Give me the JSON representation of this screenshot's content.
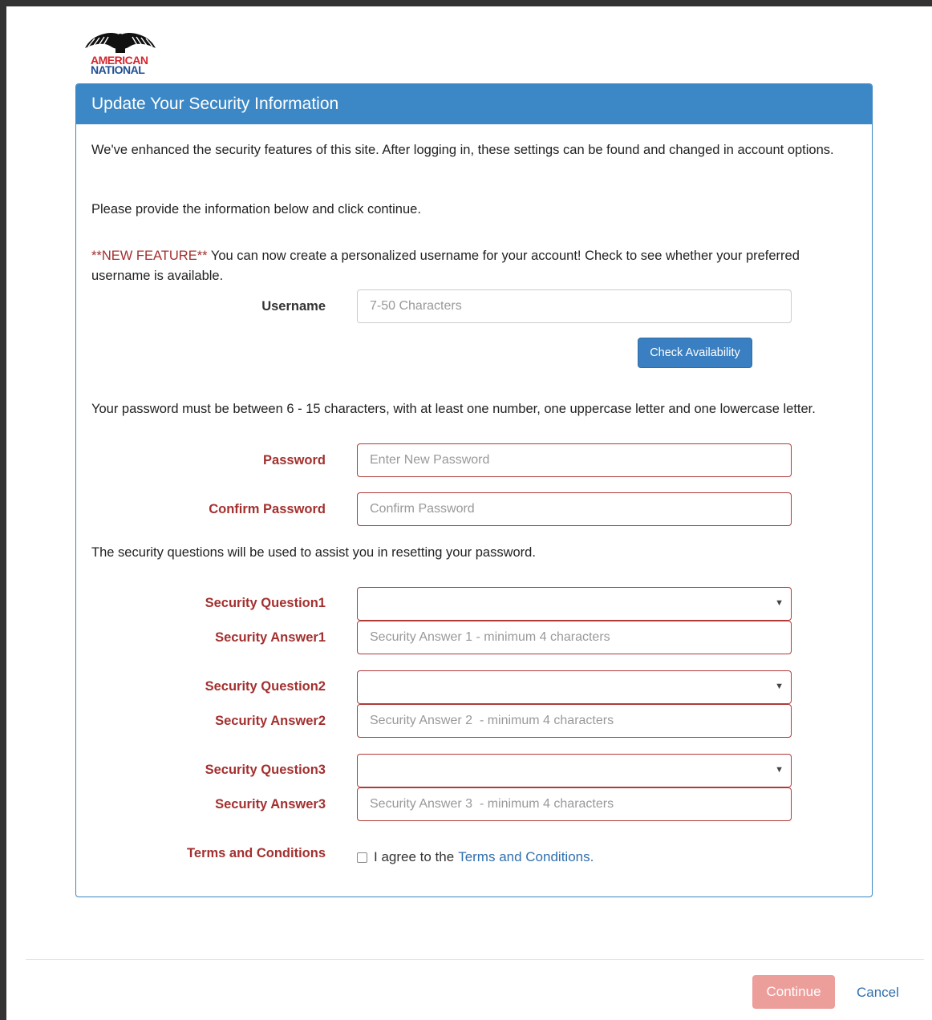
{
  "brand": {
    "line1": "AMERICAN",
    "line2": "NATIONAL",
    "colors": {
      "red": "#d4262e",
      "blue": "#1e4f93"
    }
  },
  "panel": {
    "title": "Update Your Security Information",
    "intro": "We've enhanced the security features of this site. After logging in, these settings can be found and changed in account options.",
    "instruction": "Please provide the information below and click continue.",
    "new_feature_tag": "**NEW FEATURE**",
    "new_feature_text": " You can now create a personalized username for your account! Check to see whether your preferred username is available.",
    "username": {
      "label": "Username",
      "placeholder": "7-50 Characters",
      "value": ""
    },
    "check_button": "Check Availability",
    "password_rules": "Your password must be between 6 - 15 characters, with at least one number, one uppercase letter and one lowercase letter.",
    "password": {
      "label": "Password",
      "placeholder": "Enter New Password"
    },
    "confirm_password": {
      "label": "Confirm Password",
      "placeholder": "Confirm Password"
    },
    "security_note": "The security questions will be used to assist you in resetting your password.",
    "questions": [
      {
        "q_label": "Security Question1",
        "q_value": "",
        "a_label": "Security Answer1",
        "a_placeholder": "Security Answer 1 - minimum 4 characters"
      },
      {
        "q_label": "Security Question2",
        "q_value": "",
        "a_label": "Security Answer2",
        "a_placeholder": "Security Answer 2  - minimum 4 characters"
      },
      {
        "q_label": "Security Question3",
        "q_value": "",
        "a_label": "Security Answer3",
        "a_placeholder": "Security Answer 3  - minimum 4 characters"
      }
    ],
    "terms": {
      "label": "Terms and Conditions",
      "agree_text": "I agree to the",
      "link_text": "Terms and Conditions.",
      "checked": false
    }
  },
  "footer": {
    "continue_label": "Continue",
    "cancel_label": "Cancel"
  },
  "colors": {
    "header": "#3c88c6",
    "error": "#a3302f",
    "continue_disabled": "#ec9e9b",
    "link": "#2f6fae"
  },
  "icons": {
    "logo": "eagle-icon",
    "select_caret": "caret-down-icon"
  }
}
